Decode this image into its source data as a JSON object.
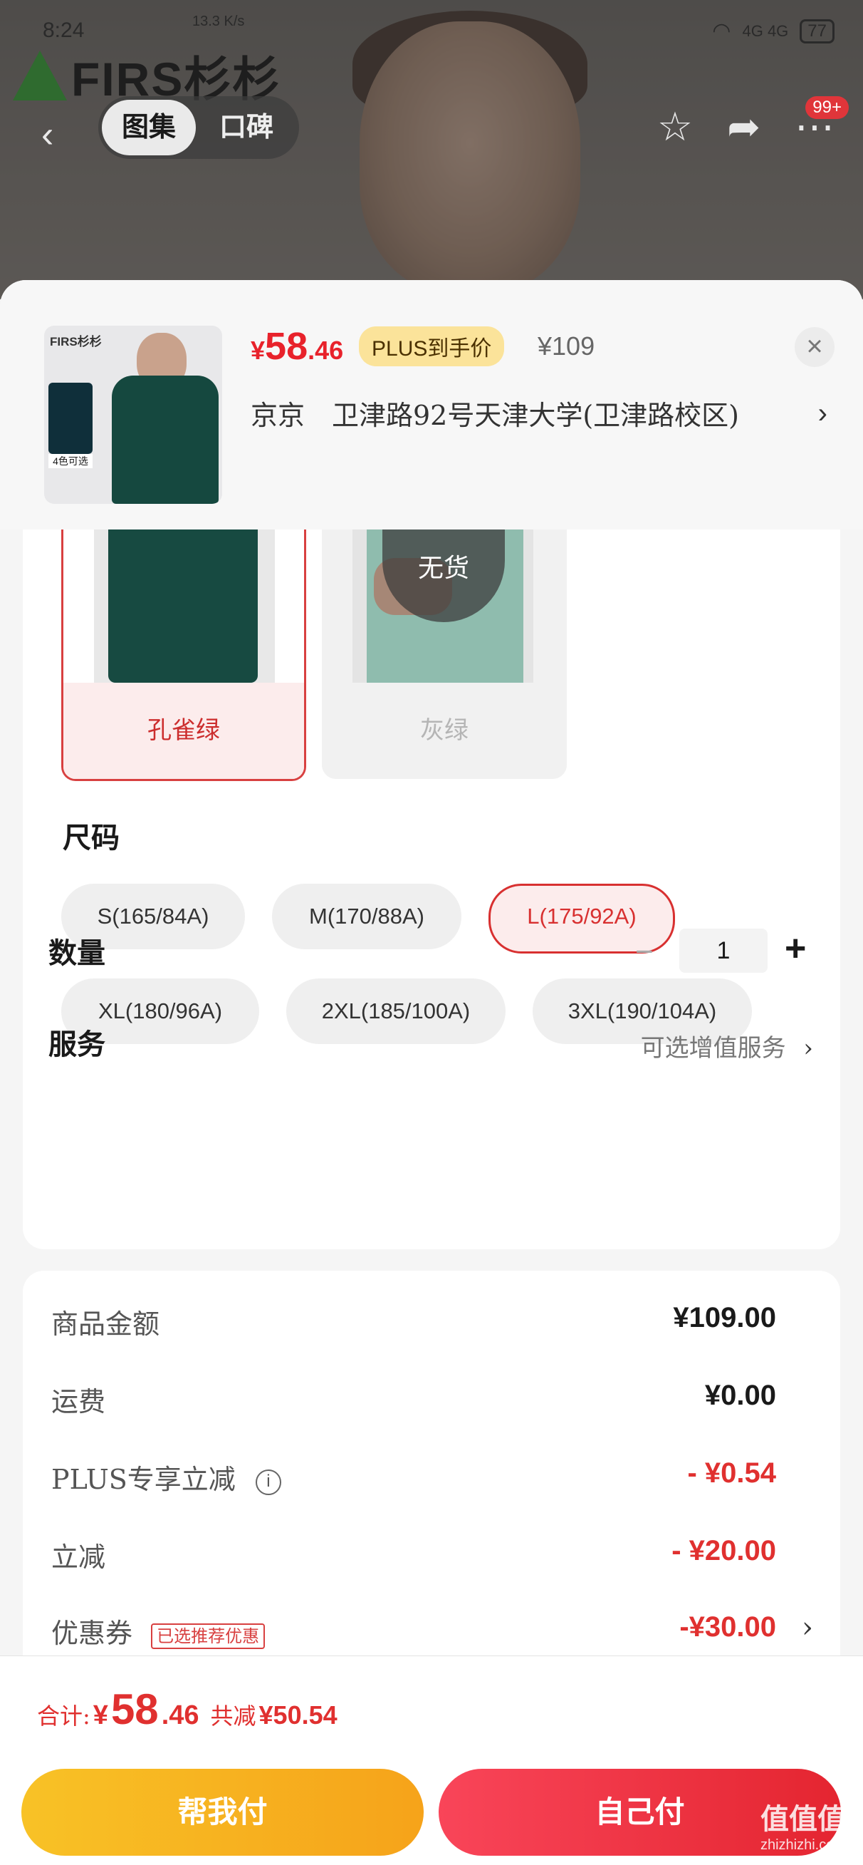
{
  "status_bar": {
    "time": "8:24",
    "net_speed": "13.3 K/s",
    "signal": "4G 4G",
    "battery": "77"
  },
  "brand": {
    "name": "FIRS杉杉"
  },
  "nav": {
    "tabs": [
      {
        "label": "图集",
        "active": true
      },
      {
        "label": "口碑",
        "active": false
      }
    ],
    "badge": "99+"
  },
  "product": {
    "thumb_logo": "FIRS杉杉",
    "thumb_colors_label": "4色可选",
    "price_symbol": "¥",
    "price_int": "58",
    "price_dec": ".46",
    "plus_tag": "PLUS到手价",
    "original_price": "¥109",
    "address": "京京　卫津路92号天津大学(卫津路校区)"
  },
  "colors": [
    {
      "label": "孔雀绿",
      "selected": true,
      "available": true
    },
    {
      "label": "灰绿",
      "selected": false,
      "available": false,
      "badge": "无货"
    }
  ],
  "sizes": {
    "title": "尺码",
    "options": [
      {
        "label": "S(165/84A)",
        "selected": false
      },
      {
        "label": "M(170/88A)",
        "selected": false
      },
      {
        "label": "L(175/92A)",
        "selected": true
      },
      {
        "label": "XL(180/96A)",
        "selected": false
      },
      {
        "label": "2XL(185/100A)",
        "selected": false
      },
      {
        "label": "3XL(190/104A)",
        "selected": false
      }
    ]
  },
  "quantity": {
    "label": "数量",
    "value": "1",
    "minus": "−",
    "plus": "+"
  },
  "service": {
    "label": "服务",
    "value": "可选增值服务"
  },
  "summary": [
    {
      "label": "商品金额",
      "value": "¥109.00",
      "red": false
    },
    {
      "label": "运费",
      "value": "¥0.00",
      "red": false
    },
    {
      "label": "PLUS专享立减",
      "value": "- ¥0.54",
      "red": true
    },
    {
      "label": "立减",
      "value": "- ¥20.00",
      "red": true
    },
    {
      "label": "优惠券",
      "tag": "已选推荐优惠",
      "value": "-¥30.00",
      "red": true
    }
  ],
  "footer": {
    "total_label": "合计:",
    "total_symbol": "¥",
    "total_int": "58",
    "total_dec": ".46",
    "saved_label": "共减",
    "saved_amount": "¥50.54",
    "help_pay": "帮我付",
    "self_pay": "自己付"
  },
  "watermark": {
    "main": "值值值",
    "sub": "zhizhizhi.com"
  },
  "colors_theme": {
    "accent_red": "#e0302f",
    "plus_yellow": "#fbe39a",
    "btn_yellow": "#f8c226",
    "btn_red": "#e42530"
  }
}
